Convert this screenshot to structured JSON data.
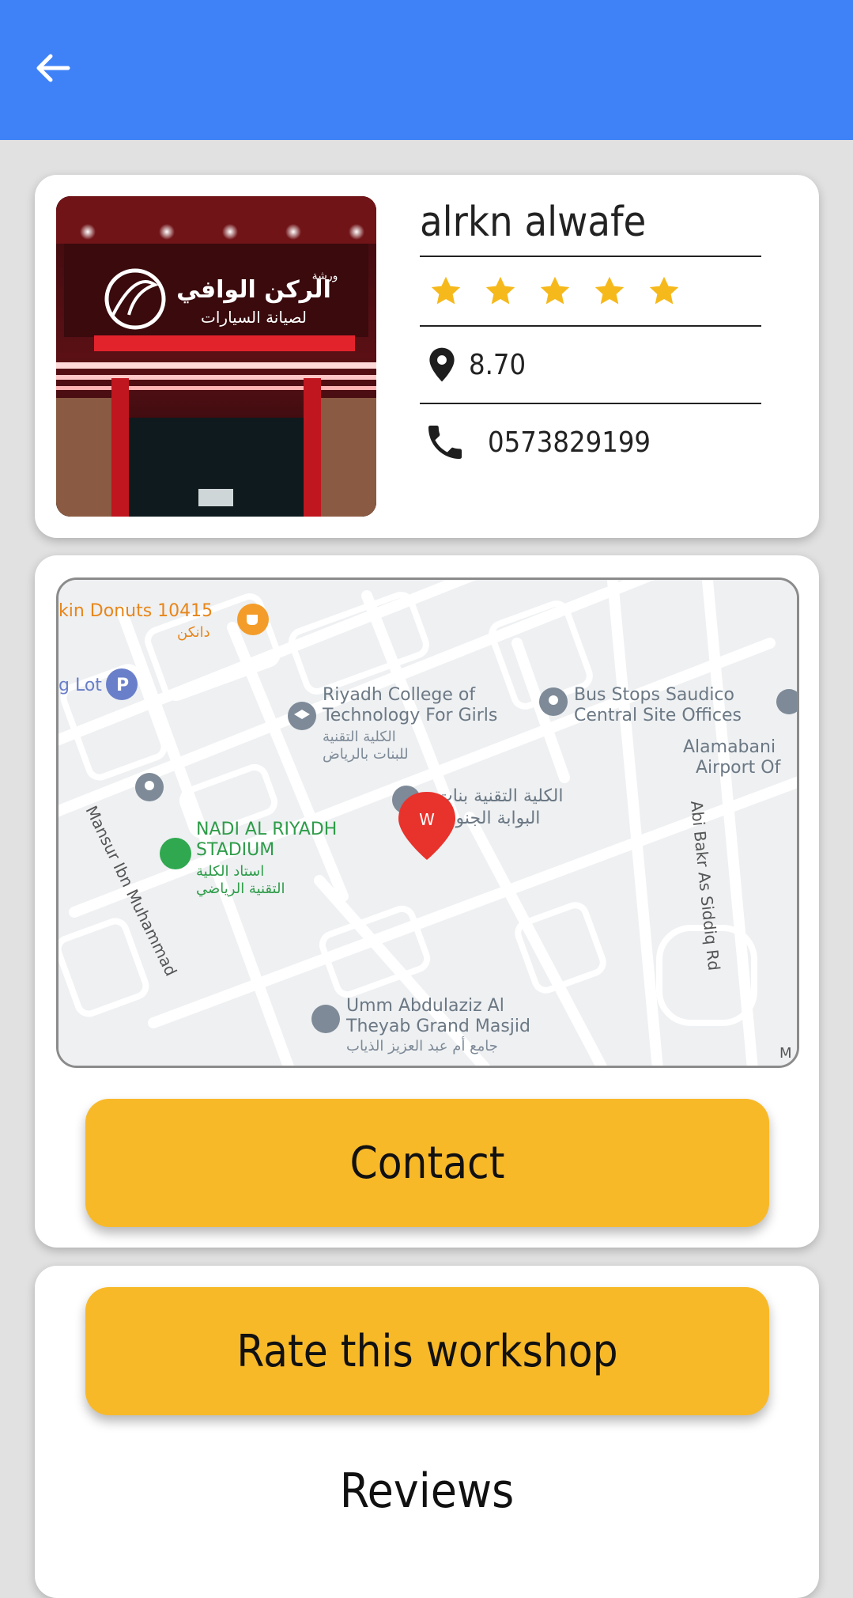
{
  "shop": {
    "name": "alrkn alwafe",
    "rating_stars": 5,
    "distance": "8.70",
    "phone": "0573829199",
    "sign_text_ar_1": "الركن الوافي",
    "sign_text_ar_2": "لصيانة السيارات",
    "sign_text_ar_3": "ورشة"
  },
  "map": {
    "labels": {
      "donuts": "kin Donuts 10415",
      "donuts_ar": "دانكن",
      "lot": "g Lot",
      "college_1": "Riyadh College of",
      "college_2": "Technology For Girls",
      "college_ar_1": "الكلية التقنية",
      "college_ar_2": "للبنات بالرياض",
      "bus_1": "Bus Stops Saudico",
      "bus_2": "Central Site Offices",
      "airport_1": "Alamabani",
      "airport_2": "Airport Of",
      "gate_ar_1": "الكلية التقنية بنات",
      "gate_ar_2": "البوابة الجنوبية",
      "stadium_1": "NADI AL RIYADH",
      "stadium_2": "STADIUM",
      "stadium_ar_1": "استاد الكلية",
      "stadium_ar_2": "التقنية الرياضي",
      "road_mansur": "Mansur Ibn Muhammad",
      "road_abibakr": "Abi Bakr As Siddiq Rd",
      "masjid_1": "Umm Abdulaziz Al",
      "masjid_2": "Theyab Grand Masjid",
      "masjid_ar": "جامع أم عبد العزيز الذياب",
      "marker": "W",
      "corner": "M"
    }
  },
  "buttons": {
    "contact": "Contact",
    "rate": "Rate this workshop"
  },
  "reviews": {
    "title": "Reviews"
  },
  "colors": {
    "appbar": "#3f82f7",
    "accent": "#f8b929",
    "star": "#f6b91c",
    "background": "#e1e1e1"
  },
  "icons": {
    "back": "arrow-left-icon",
    "star": "star-icon",
    "location": "location-pin-icon",
    "phone": "phone-icon"
  }
}
